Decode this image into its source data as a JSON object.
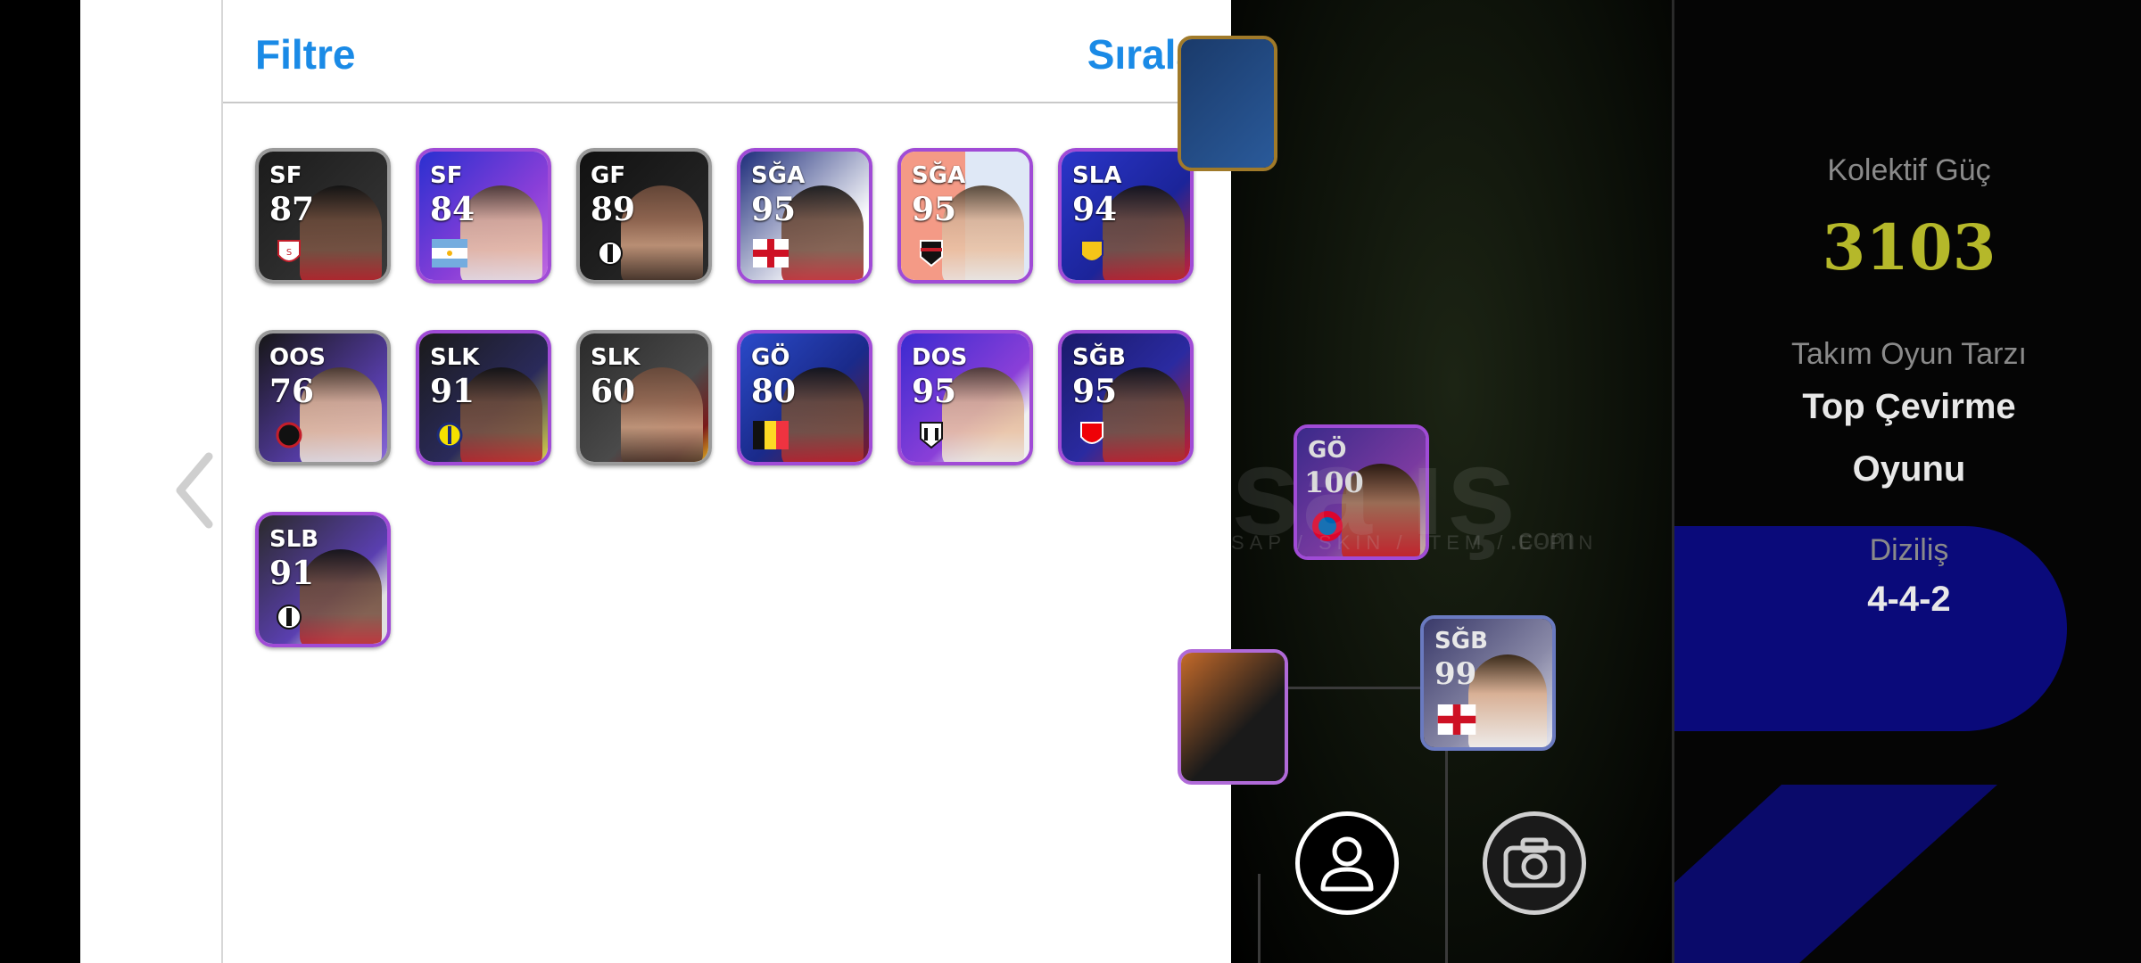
{
  "header": {
    "filter_label": "Filtre",
    "sort_label": "Sırala"
  },
  "cards": [
    {
      "position": "SF",
      "rating": "87",
      "emblem": "club-crest"
    },
    {
      "position": "SF",
      "rating": "84",
      "emblem": "argentina-flag"
    },
    {
      "position": "GF",
      "rating": "89",
      "emblem": "club-crest"
    },
    {
      "position": "SĞA",
      "rating": "95",
      "emblem": "england-flag"
    },
    {
      "position": "SĞA",
      "rating": "95",
      "emblem": "club-crest"
    },
    {
      "position": "SLA",
      "rating": "94",
      "emblem": "club-crest"
    },
    {
      "position": "OOS",
      "rating": "76",
      "emblem": "club-crest"
    },
    {
      "position": "SLK",
      "rating": "91",
      "emblem": "club-crest"
    },
    {
      "position": "SLK",
      "rating": "60",
      "emblem": "none"
    },
    {
      "position": "GÖ",
      "rating": "80",
      "emblem": "belgium-flag"
    },
    {
      "position": "DOS",
      "rating": "95",
      "emblem": "club-crest"
    },
    {
      "position": "SĞB",
      "rating": "95",
      "emblem": "club-crest"
    },
    {
      "position": "SLB",
      "rating": "91",
      "emblem": "club-crest"
    }
  ],
  "field": {
    "cards": [
      {
        "position": "GÖ",
        "rating": "100"
      },
      {
        "position": "SĞB",
        "rating": "99"
      }
    ],
    "watermark": "sa ış",
    "watermark_sub": "SAP / SKIN / ITEM / E-PIN",
    "watermark_com": ".com"
  },
  "stats": {
    "collective_label": "Kolektif Güç",
    "collective_value": "3103",
    "style_label": "Takım Oyun Tarzı",
    "style_value_line1": "Top Çevirme",
    "style_value_line2": "Oyunu",
    "formation_label": "Diziliş",
    "formation_value": "4-4-2"
  },
  "colors": {
    "accent_blue": "#1a8ae6",
    "card_purple": "#a04bd6",
    "power_yellow": "#b5b82a"
  }
}
